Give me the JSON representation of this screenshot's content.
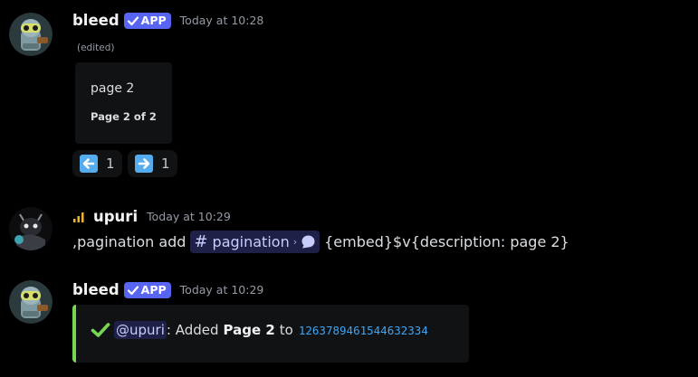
{
  "messages": [
    {
      "author": "bleed",
      "tag": "APP",
      "timestamp": "Today at 10:28",
      "edited": "(edited)",
      "embed": {
        "title": "page 2",
        "footer": "Page 2 of 2"
      },
      "reactions": [
        {
          "icon": "arrow-left-emoji",
          "count": "1"
        },
        {
          "icon": "arrow-right-emoji",
          "count": "1"
        }
      ]
    },
    {
      "author": "upuri",
      "timestamp": "Today at 10:29",
      "content_prefix": ",pagination add",
      "channel": "pagination",
      "content_suffix": "{embed}$v{description: page 2}"
    },
    {
      "author": "bleed",
      "tag": "APP",
      "timestamp": "Today at 10:29",
      "embed": {
        "mention": "@upuri",
        "text_1": ": Added",
        "bold": "Page 2",
        "text_2": "to",
        "id": "1263789461544632334"
      }
    }
  ],
  "colors": {
    "background": "#000000",
    "app_tag": "#5865f2",
    "embed_border": "#78d655",
    "mention_bg": "#1e2048",
    "id_text": "#3ea5f5"
  }
}
